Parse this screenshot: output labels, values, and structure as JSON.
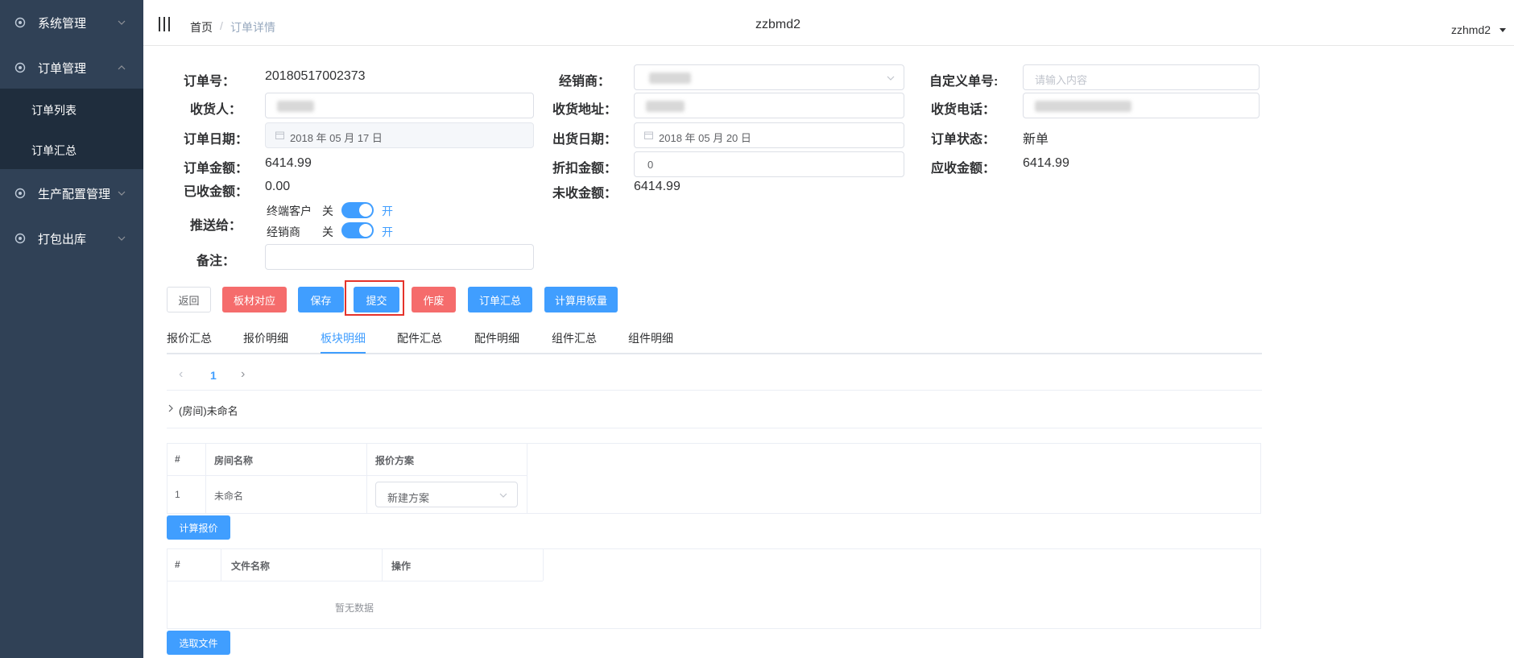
{
  "sidebar": {
    "menus": [
      {
        "label": "系统管理",
        "icon": "settings-icon",
        "expanded": false
      },
      {
        "label": "订单管理",
        "icon": "settings-icon",
        "expanded": true
      },
      {
        "label": "生产配置管理",
        "icon": "settings-icon",
        "expanded": false
      },
      {
        "label": "打包出库",
        "icon": "settings-icon",
        "expanded": false
      }
    ],
    "submenu": [
      {
        "label": "订单列表"
      },
      {
        "label": "订单汇总"
      }
    ]
  },
  "header": {
    "breadcrumb": [
      "首页",
      "/",
      "订单详情"
    ],
    "title": "zzbmd2",
    "user": "zzhmd2"
  },
  "form": {
    "order_no": {
      "label": "订单号：",
      "value": "20180517002373"
    },
    "dealer": {
      "label": "经销商："
    },
    "custom_no": {
      "label": "自定义单号:",
      "placeholder": "请输入内容"
    },
    "receiver": {
      "label": "收货人："
    },
    "address": {
      "label": "收货地址："
    },
    "phone": {
      "label": "收货电话："
    },
    "order_date": {
      "label": "订单日期：",
      "value": "2018 年 05 月 17 日"
    },
    "ship_date": {
      "label": "出货日期：",
      "value": "2018 年 05 月 20 日"
    },
    "status": {
      "label": "订单状态：",
      "value": "新单"
    },
    "order_amount": {
      "label": "订单金额：",
      "value": "6414.99"
    },
    "discount": {
      "label": "折扣金额：",
      "value": "0"
    },
    "receivable": {
      "label": "应收金额：",
      "value": "6414.99"
    },
    "received": {
      "label": "已收金额：",
      "value": "0.00"
    },
    "unreceived": {
      "label": "未收金额：",
      "value": "6414.99"
    },
    "push_to": {
      "label": "推送给：",
      "rows": [
        {
          "name": "终端客户",
          "off": "关",
          "on": "开"
        },
        {
          "name": "经销商",
          "off": "关",
          "on": "开"
        }
      ]
    },
    "remark": {
      "label": "备注："
    }
  },
  "actions": {
    "back": "返回",
    "panel_match": "板材对应",
    "save": "保存",
    "submit": "提交",
    "void": "作废",
    "order_summary": "订单汇总",
    "calc_board": "计算用板量"
  },
  "tabs": [
    "报价汇总",
    "报价明细",
    "板块明细",
    "配件汇总",
    "配件明细",
    "组件汇总",
    "组件明细"
  ],
  "active_tab": "板块明细",
  "pagination": {
    "prev": "‹",
    "current": "1",
    "next": "›"
  },
  "room_group": "(房间)未命名",
  "room_table": {
    "headers": [
      "#",
      "房间名称",
      "报价方案"
    ],
    "rows": [
      {
        "index": "1",
        "name": "未命名",
        "plan": "新建方案"
      }
    ]
  },
  "calc_price_button": "计算报价",
  "file_table": {
    "headers": [
      "#",
      "文件名称",
      "操作"
    ],
    "empty": "暂无数据"
  },
  "select_file_button": "选取文件",
  "colors": {
    "sidebar": "#304156",
    "primary": "#409eff",
    "danger": "#f56c6c",
    "highlight": "#e5332b"
  }
}
